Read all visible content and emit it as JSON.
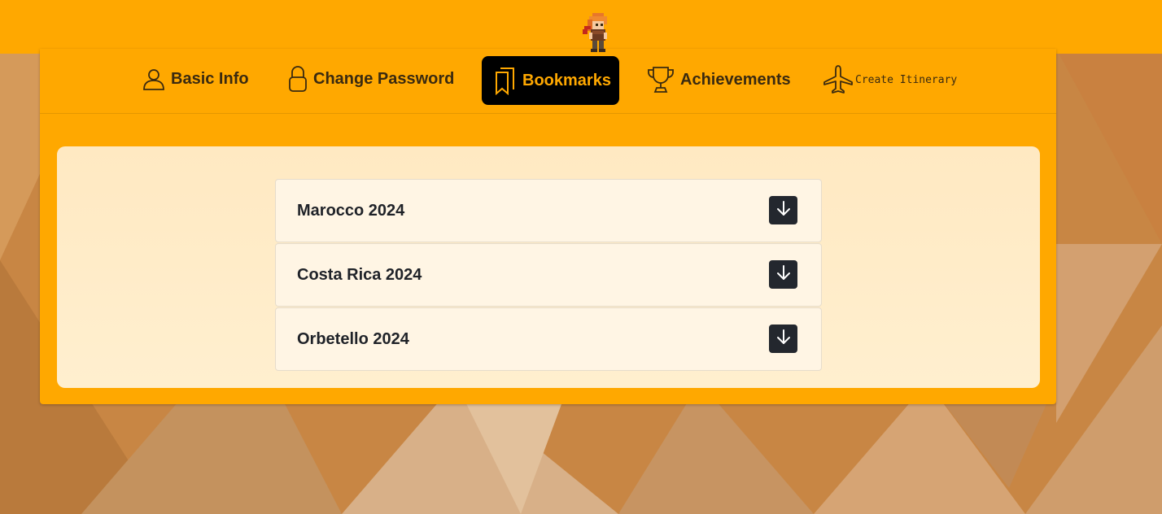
{
  "colors": {
    "accent": "#ffa800",
    "active_tab_bg": "#000000",
    "panel_bg": "#ffecc9",
    "row_bg": "#fff5e4",
    "button_bg": "#23272e"
  },
  "header": {
    "mascot_icon": "pixel-character-icon"
  },
  "nav": {
    "items": [
      {
        "label": "Basic Info",
        "icon": "user-icon"
      },
      {
        "label": "Change Password",
        "icon": "lock-icon"
      },
      {
        "label": "Bookmarks",
        "icon": "bookmarks-icon",
        "active": true
      },
      {
        "label": "Achievements",
        "icon": "trophy-icon"
      },
      {
        "label": "Create Itinerary",
        "icon": "airplane-icon"
      }
    ]
  },
  "bookmarks": {
    "items": [
      {
        "title": "Marocco 2024",
        "action_icon": "arrow-down-icon"
      },
      {
        "title": "Costa Rica 2024",
        "action_icon": "arrow-down-icon"
      },
      {
        "title": "Orbetello 2024",
        "action_icon": "arrow-down-icon"
      }
    ]
  }
}
